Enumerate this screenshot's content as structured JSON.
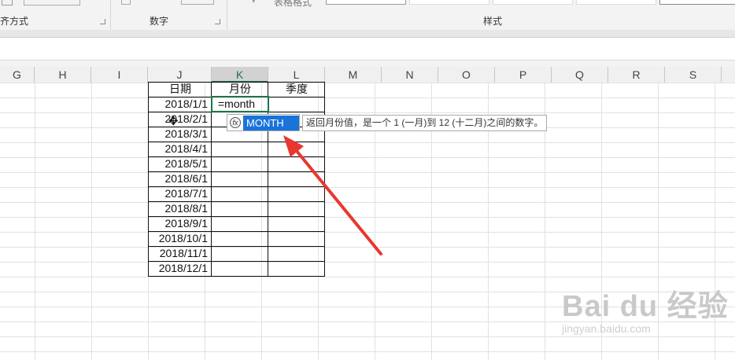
{
  "ribbon": {
    "group_alignment_label": "齐方式",
    "group_number_label": "数字",
    "group_styles_label": "样式",
    "table_format_label": "表格格式"
  },
  "columns": [
    "G",
    "H",
    "I",
    "J",
    "K",
    "L",
    "M",
    "N",
    "O",
    "P",
    "Q",
    "R",
    "S"
  ],
  "selected_column": "K",
  "table": {
    "headers": [
      "日期",
      "月份",
      "季度"
    ],
    "dates": [
      "2018/1/1",
      "2018/2/1",
      "2018/3/1",
      "2018/4/1",
      "2018/5/1",
      "2018/6/1",
      "2018/7/1",
      "2018/8/1",
      "2018/9/1",
      "2018/10/1",
      "2018/11/1",
      "2018/12/1"
    ],
    "active_cell_value": "=month"
  },
  "autocomplete": {
    "icon": "function-icon",
    "item": "MONTH",
    "tooltip": "返回月份值，是一个 1 (一月)到 12 (十二月)之间的数字。"
  },
  "annotation": {
    "arrow_color": "#e8372f"
  },
  "watermark": {
    "brand": "Bai du 经验",
    "url": "jingyan.baidu.com"
  }
}
